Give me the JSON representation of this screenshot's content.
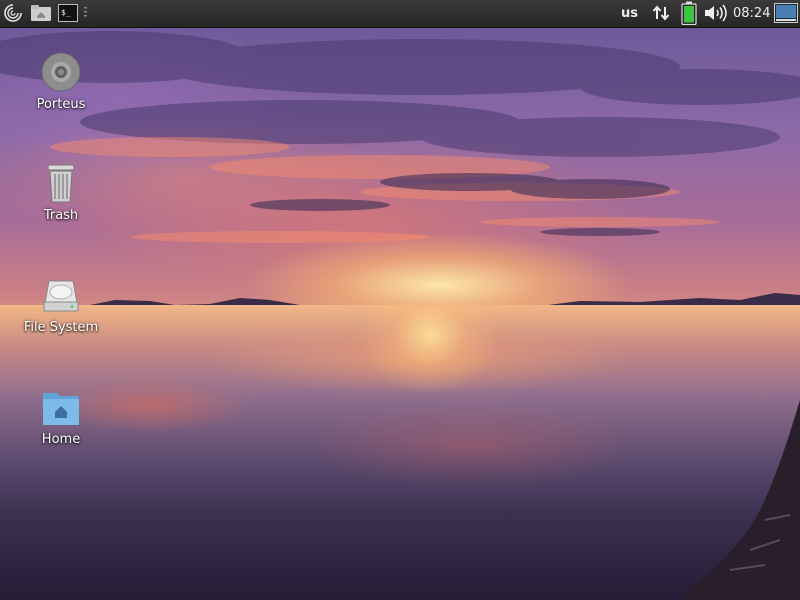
{
  "panel": {
    "keyboard_layout": "us",
    "clock": "08:24",
    "launchers": [
      "porteus-menu-icon",
      "file-manager-icon",
      "terminal-icon"
    ],
    "tray_icons": [
      "network-icon",
      "battery-icon",
      "volume-icon",
      "show-desktop-icon"
    ]
  },
  "desktop": {
    "icons": [
      {
        "label": "Porteus",
        "icon": "optical-disc-icon"
      },
      {
        "label": "Trash",
        "icon": "trash-icon"
      },
      {
        "label": "File System",
        "icon": "hard-drive-icon"
      },
      {
        "label": "Home",
        "icon": "home-folder-icon"
      }
    ]
  },
  "colors": {
    "panel_bg": "#2e2e2e",
    "battery_green": "#3fc53f",
    "folder_blue": "#6fb3e8"
  }
}
